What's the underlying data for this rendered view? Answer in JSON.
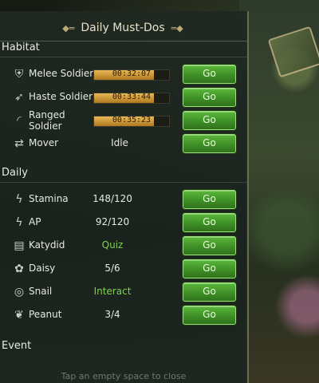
{
  "title": "Daily Must-Dos",
  "sections": {
    "habitat": "Habitat",
    "daily": "Daily",
    "event": "Event"
  },
  "habitat_rows": [
    {
      "icon": "melee-soldier-icon",
      "label": "Melee Soldier",
      "timer": "00:32:07",
      "progress": 0.8,
      "button": "Go"
    },
    {
      "icon": "haste-soldier-icon",
      "label": "Haste Soldier",
      "timer": "00:33:44",
      "progress": 0.8,
      "button": "Go"
    },
    {
      "icon": "ranged-soldier-icon",
      "label": "Ranged Soldier",
      "timer": "00:35:23",
      "progress": 0.8,
      "button": "Go"
    },
    {
      "icon": "mover-icon",
      "label": "Mover",
      "value": "Idle",
      "button": "Go"
    }
  ],
  "daily_rows": [
    {
      "icon": "stamina-icon",
      "label": "Stamina",
      "value": "148/120",
      "button": "Go"
    },
    {
      "icon": "ap-icon",
      "label": "AP",
      "value": "92/120",
      "button": "Go"
    },
    {
      "icon": "katydid-icon",
      "label": "Katydid",
      "value": "Quiz",
      "button": "Go"
    },
    {
      "icon": "daisy-icon",
      "label": "Daisy",
      "value": "5/6",
      "button": "Go"
    },
    {
      "icon": "snail-icon",
      "label": "Snail",
      "value": "Interact",
      "button": "Go"
    },
    {
      "icon": "peanut-icon",
      "label": "Peanut",
      "value": "3/4",
      "button": "Go"
    }
  ],
  "footer": "Tap an empty space to close",
  "colors": {
    "accent_green": "#4aa52e",
    "value_green": "#7fd24c",
    "bar_gold": "#d9a441"
  }
}
